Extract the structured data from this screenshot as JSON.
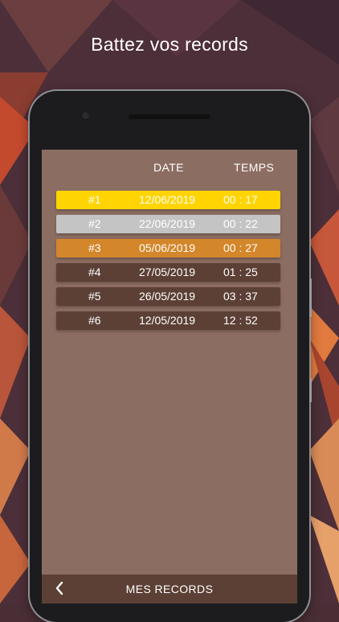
{
  "promo": {
    "title": "Battez vos records"
  },
  "table": {
    "headers": {
      "date": "DATE",
      "time": "TEMPS"
    },
    "rows": [
      {
        "rank": "#1",
        "date": "12/06/2019",
        "time": "00 : 17",
        "color": "#ffd400"
      },
      {
        "rank": "#2",
        "date": "22/06/2019",
        "time": "00 : 22",
        "color": "#c4c4c4"
      },
      {
        "rank": "#3",
        "date": "05/06/2019",
        "time": "00 : 27",
        "color": "#d3862a"
      },
      {
        "rank": "#4",
        "date": "27/05/2019",
        "time": "01 : 25",
        "color": "#5c4035"
      },
      {
        "rank": "#5",
        "date": "26/05/2019",
        "time": "03 : 37",
        "color": "#5c4035"
      },
      {
        "rank": "#6",
        "date": "12/05/2019",
        "time": "12 : 52",
        "color": "#5c4035"
      }
    ]
  },
  "bottom_bar": {
    "title": "MES RECORDS",
    "back_icon": "chevron-left-icon"
  }
}
